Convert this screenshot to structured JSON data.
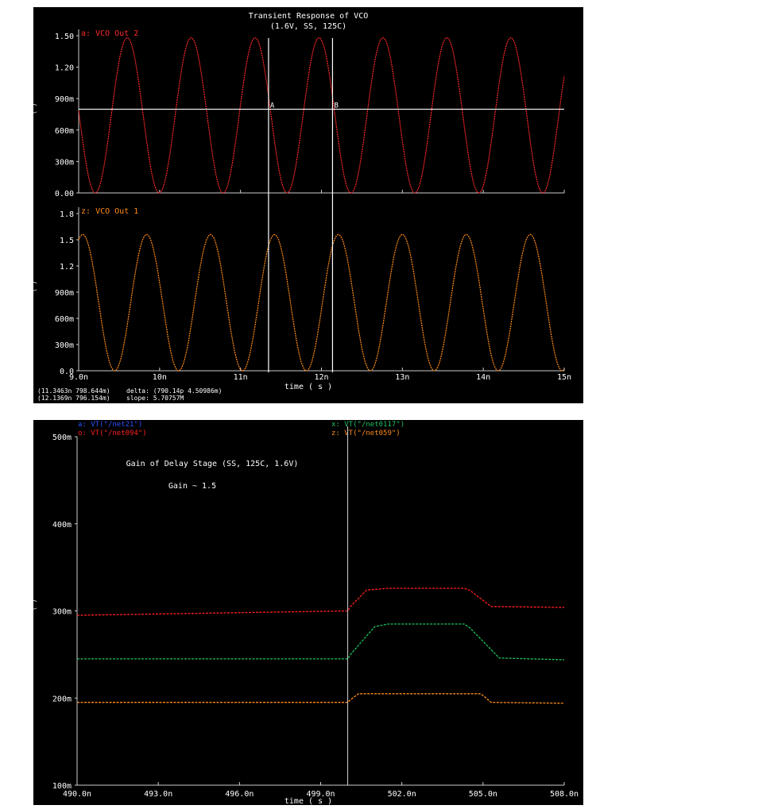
{
  "chart_data": [
    {
      "type": "line",
      "title": "Transient Response of VCO",
      "subtitle": "(1.6V, SS, 125C)",
      "xlabel": "time ( s )",
      "x_ticks": [
        "9.0n",
        "10n",
        "11n",
        "12n",
        "13n",
        "14n",
        "15n"
      ],
      "xlim": [
        9.0,
        15.0
      ],
      "x_unit": "ns",
      "grid": false,
      "subplots": [
        {
          "marker": "a:",
          "series_name": "VCO Out 2",
          "color": "#ff2a2a",
          "y_ticks": [
            "1.50",
            "1.20",
            "900m",
            "600m",
            "300m",
            "0.00"
          ],
          "ylim": [
            0.0,
            1.5
          ],
          "waveform": {
            "shape": "sine",
            "min": 0.0,
            "max": 1.48,
            "period_ns": 0.79,
            "first_peak_ns": 9.6,
            "start_ns": 9.0,
            "end_ns": 15.0
          }
        },
        {
          "marker": "z:",
          "series_name": "VCO Out 1",
          "color": "#ff8c1a",
          "y_ticks": [
            "1.8",
            "1.5",
            "1.2",
            "900m",
            "600m",
            "300m",
            "0.0"
          ],
          "ylim": [
            0.0,
            1.8
          ],
          "waveform": {
            "shape": "sine",
            "min": 0.0,
            "max": 1.56,
            "period_ns": 0.79,
            "first_peak_ns": 9.05,
            "start_ns": 9.0,
            "end_ns": 15.0
          }
        }
      ],
      "cursors": [
        {
          "label": "A",
          "x_ns": 11.3463,
          "y": 0.7986
        },
        {
          "label": "B",
          "x_ns": 12.1369,
          "y": 0.7962
        }
      ],
      "horizontal_marker_y": 0.7986,
      "cursor_readout": [
        "(11.3463n 798.644m)",
        "(12.1369n 796.154m)"
      ],
      "delta_readout": [
        "delta: (790.14p 4.50986m)",
        "slope: 5.70757M"
      ]
    },
    {
      "type": "line",
      "title": "Gain of Delay Stage (SS, 125C, 1.6V)",
      "annotation": "Gain ~ 1.5",
      "xlabel": "time ( s )",
      "x_ticks": [
        "490.0n",
        "493.0n",
        "496.0n",
        "499.0n",
        "502.0n",
        "505.0n",
        "508.0n"
      ],
      "xlim": [
        490.0,
        508.0
      ],
      "x_unit": "ns",
      "y_ticks": [
        "500m",
        "400m",
        "300m",
        "200m",
        "100m"
      ],
      "ylim": [
        0.1,
        0.5
      ],
      "grid": false,
      "legend": [
        {
          "marker": "a:",
          "label": "VT(\"/net21\")",
          "color": "#3050ff"
        },
        {
          "marker": "o:",
          "label": "VT(\"/net094\")",
          "color": "#ff2020"
        },
        {
          "marker": "x:",
          "label": "VT(\"/net0117\")",
          "color": "#20c060"
        },
        {
          "marker": "z:",
          "label": "VT(\"/net059\")",
          "color": "#ff8c1a"
        }
      ],
      "vertical_marker_x": 500.0,
      "series": [
        {
          "name": "VT(\"/net094\")",
          "color": "#ff2020",
          "points": [
            [
              490.0,
              0.295
            ],
            [
              500.0,
              0.3
            ],
            [
              500.1,
              0.305
            ],
            [
              500.7,
              0.324
            ],
            [
              501.5,
              0.326
            ],
            [
              504.3,
              0.326
            ],
            [
              504.5,
              0.324
            ],
            [
              505.3,
              0.305
            ],
            [
              508.0,
              0.304
            ]
          ]
        },
        {
          "name": "VT(\"/net0117\")",
          "color": "#20c060",
          "points": [
            [
              490.0,
              0.245
            ],
            [
              500.0,
              0.245
            ],
            [
              500.1,
              0.25
            ],
            [
              501.0,
              0.282
            ],
            [
              501.5,
              0.285
            ],
            [
              504.3,
              0.285
            ],
            [
              504.5,
              0.281
            ],
            [
              505.6,
              0.246
            ],
            [
              508.0,
              0.244
            ]
          ]
        },
        {
          "name": "VT(\"/net059\")",
          "color": "#ff8c1a",
          "points": [
            [
              490.0,
              0.195
            ],
            [
              500.0,
              0.195
            ],
            [
              500.1,
              0.198
            ],
            [
              500.4,
              0.205
            ],
            [
              504.9,
              0.205
            ],
            [
              505.0,
              0.203
            ],
            [
              505.3,
              0.195
            ],
            [
              508.0,
              0.194
            ]
          ]
        }
      ]
    }
  ]
}
